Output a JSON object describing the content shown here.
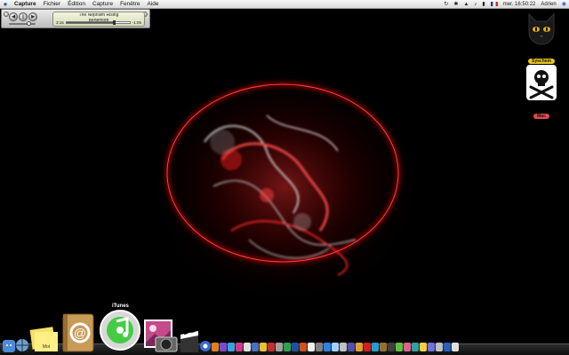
{
  "menubar": {
    "app": "Capture",
    "items": [
      "Fichier",
      "Édition",
      "Capture",
      "Fenêtre",
      "Aide"
    ],
    "clock": "mer. 16:50:22",
    "user": "Adrien"
  },
  "mini_player": {
    "song": "The Nephilim Rising",
    "artist": "Behemoth",
    "elapsed": "3:15",
    "remaining": "-1:05",
    "progress": 0.75,
    "volume": 0.7
  },
  "desktop": {
    "icons": [
      {
        "label": "Syschem",
        "badge_color": "#e8c51c"
      },
      {
        "label": "Mac",
        "badge_color": "#e24a4a"
      }
    ]
  },
  "dock": {
    "hover_label": "iTunes",
    "stickies_text": "Mot"
  },
  "colors": {
    "accent_red": "#ff1a1a"
  }
}
